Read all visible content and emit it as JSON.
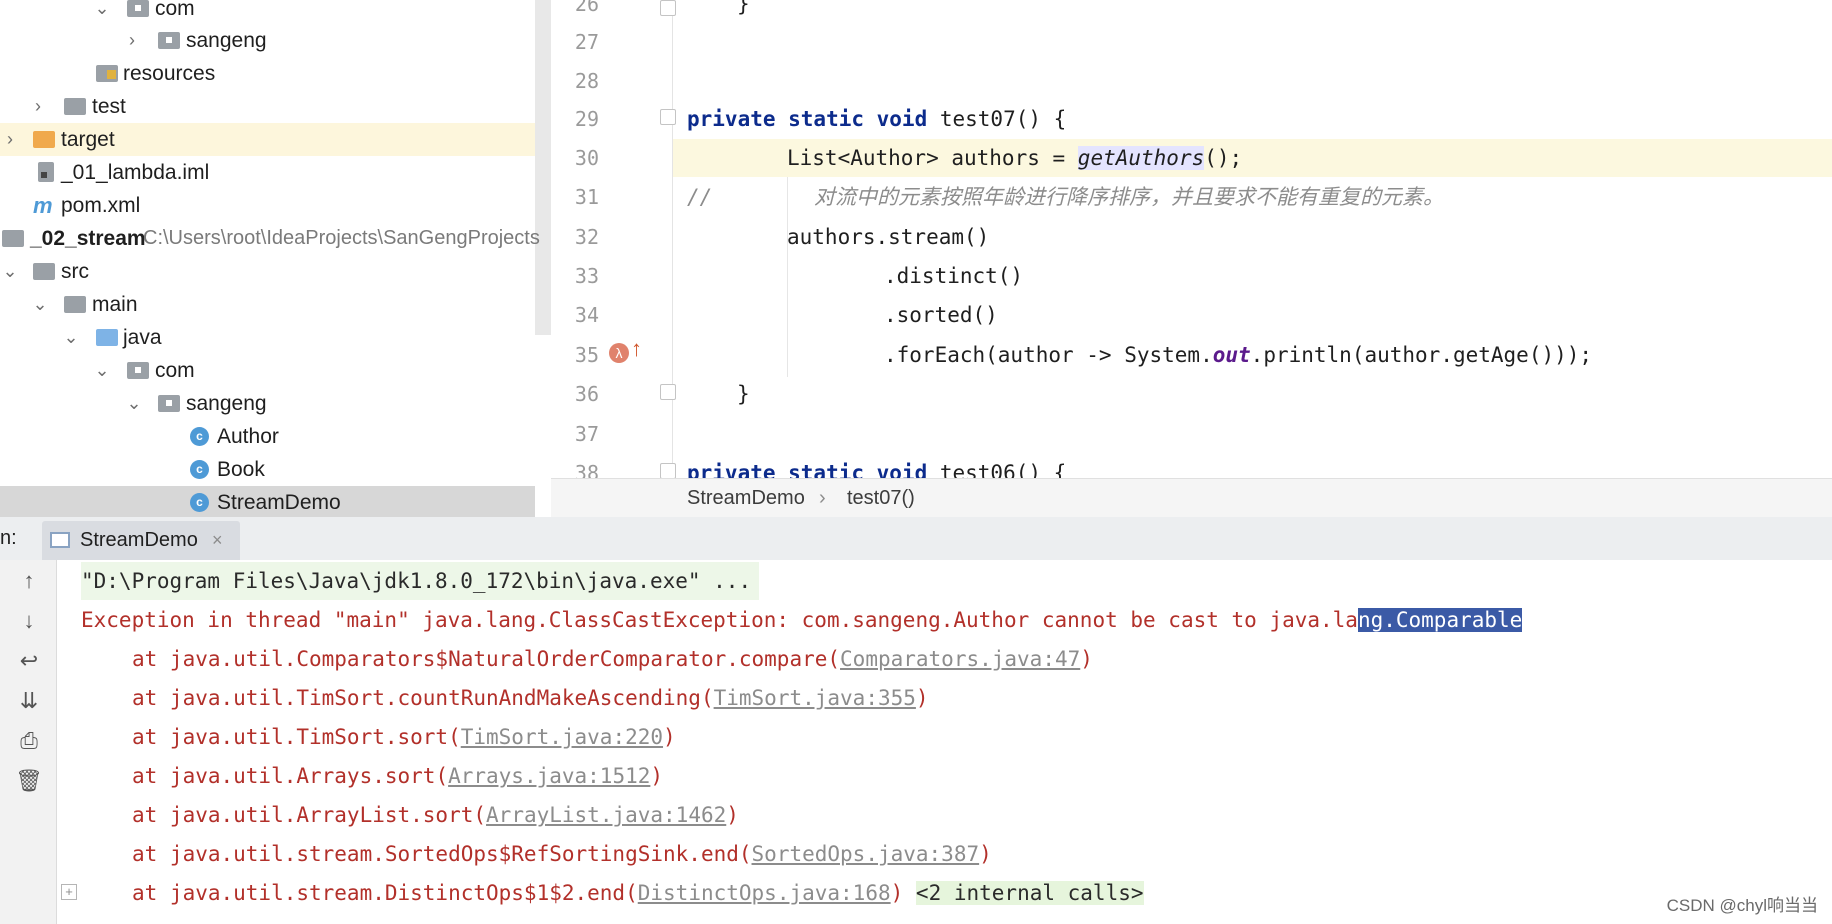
{
  "project": {
    "items": [
      {
        "label": "com",
        "icon": "package-folder-icon"
      },
      {
        "label": "sangeng",
        "icon": "package-folder-icon"
      },
      {
        "label": "resources",
        "icon": "resources-folder-icon"
      },
      {
        "label": "test",
        "icon": "folder-icon"
      },
      {
        "label": "target",
        "icon": "excluded-folder-icon"
      },
      {
        "label": "_01_lambda.iml",
        "icon": "module-file-icon"
      },
      {
        "label": "pom.xml",
        "icon": "maven-icon"
      },
      {
        "label": "_02_stream",
        "icon": "module-folder-icon",
        "path": "C:\\Users\\root\\IdeaProjects\\SanGengProjects"
      },
      {
        "label": "src",
        "icon": "folder-icon"
      },
      {
        "label": "main",
        "icon": "folder-icon"
      },
      {
        "label": "java",
        "icon": "source-folder-icon"
      },
      {
        "label": "com",
        "icon": "package-folder-icon"
      },
      {
        "label": "sangeng",
        "icon": "package-folder-icon"
      },
      {
        "label": "Author",
        "icon": "class-icon"
      },
      {
        "label": "Book",
        "icon": "class-icon"
      },
      {
        "label": "StreamDemo",
        "icon": "runnable-class-icon"
      }
    ]
  },
  "editor": {
    "line_numbers": [
      "26",
      "27",
      "28",
      "29",
      "30",
      "31",
      "32",
      "33",
      "34",
      "35",
      "36",
      "37",
      "38"
    ],
    "code": {
      "l26": "}",
      "l29_kw": "private static void",
      "l29_rest": " test07() {",
      "l30_a": "List<Author> authors = ",
      "l30_b": "getAuthors",
      "l30_c": "();",
      "l31_slashes": "//",
      "l31_comment": "对流中的元素按照年龄进行降序排序，并且要求不能有重复的元素。",
      "l32": "authors.stream()",
      "l33": ".distinct()",
      "l34": ".sorted()",
      "l35_a": ".forEach(author -> System.",
      "l35_b": "out",
      "l35_c": ".println(author.getAge()));",
      "l36": "}",
      "l38_kw": "private static void",
      "l38_rest": " test06() {"
    },
    "breadcrumb": {
      "class_name": "StreamDemo",
      "sep": "›",
      "method": "test07()"
    }
  },
  "run": {
    "label": "n:",
    "tab_title": "StreamDemo",
    "tab_close": "×",
    "command": "\"D:\\Program Files\\Java\\jdk1.8.0_172\\bin\\java.exe\" ...",
    "exception_prefix": "Exception in thread \"main\" java.lang.ClassCastException: com.sangeng.Author cannot be cast to java.la",
    "exception_selected": "ng.Comparable",
    "stack": [
      {
        "method": "at java.util.Comparators$NaturalOrderComparator.compare",
        "link": "Comparators.java:47"
      },
      {
        "method": "at java.util.TimSort.countRunAndMakeAscending",
        "link": "TimSort.java:355"
      },
      {
        "method": "at java.util.TimSort.sort",
        "link": "TimSort.java:220"
      },
      {
        "method": "at java.util.Arrays.sort",
        "link": "Arrays.java:1512"
      },
      {
        "method": "at java.util.ArrayList.sort",
        "link": "ArrayList.java:1462"
      },
      {
        "method": "at java.util.stream.SortedOps$RefSortingSink.end",
        "link": "SortedOps.java:387"
      },
      {
        "method": "at java.util.stream.DistinctOps$1$2.end",
        "link": "DistinctOps.java:168"
      }
    ],
    "internal_calls": "<2 internal calls>",
    "toolbar": [
      "up-arrow-icon",
      "down-arrow-icon",
      "soft-wrap-icon",
      "scroll-to-end-icon",
      "print-icon",
      "trash-icon"
    ]
  },
  "watermark": "CSDN @chyl响当当"
}
